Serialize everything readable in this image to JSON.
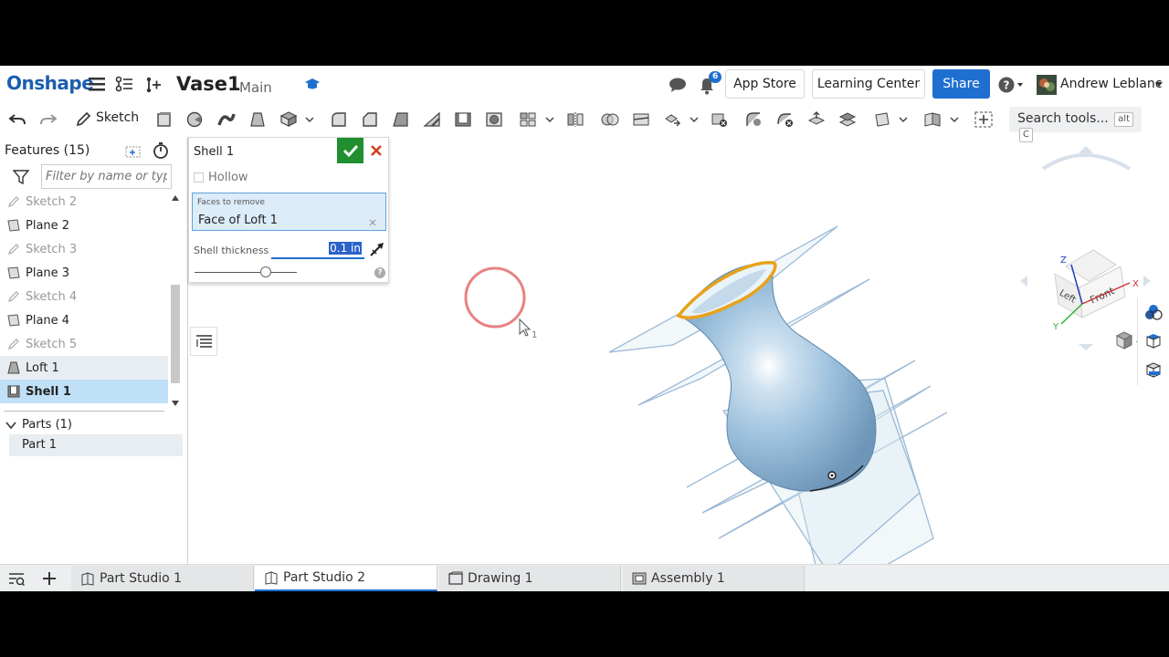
{
  "app": {
    "logo": "Onshape",
    "doc_title": "Vase1",
    "branch": "Main",
    "notification_count": "6",
    "app_store": "App Store",
    "learning_center": "Learning Center",
    "share": "Share",
    "user_name": "Andrew Leblanc"
  },
  "toolbar": {
    "sketch_label": "Sketch",
    "search_label": "Search tools...",
    "search_key_alt": "alt",
    "search_key_c": "C"
  },
  "features": {
    "header": "Features (15)",
    "filter_placeholder": "Filter by name or type",
    "items": [
      {
        "label": "Sketch 2",
        "type": "sketch"
      },
      {
        "label": "Plane 2",
        "type": "plane"
      },
      {
        "label": "Sketch 3",
        "type": "sketch"
      },
      {
        "label": "Plane 3",
        "type": "plane"
      },
      {
        "label": "Sketch 4",
        "type": "sketch"
      },
      {
        "label": "Plane 4",
        "type": "plane"
      },
      {
        "label": "Sketch 5",
        "type": "sketch"
      },
      {
        "label": "Loft 1",
        "type": "loft"
      },
      {
        "label": "Shell 1",
        "type": "shell"
      }
    ],
    "parts_header": "Parts (1)",
    "part": "Part 1"
  },
  "shell_dialog": {
    "title": "Shell 1",
    "hollow_label": "Hollow",
    "faces_label": "Faces to remove",
    "faces_value": "Face of Loft 1",
    "thickness_label": "Shell thickness",
    "thickness_value": "0.1 in",
    "help": "?"
  },
  "view_cube": {
    "face_front": "Front",
    "face_left": "Left",
    "axis_x": "X",
    "axis_y": "Y",
    "axis_z": "Z"
  },
  "viewport": {
    "cursor_badge": "1"
  },
  "tabs": [
    {
      "label": "Part Studio 1",
      "active": false
    },
    {
      "label": "Part Studio 2",
      "active": true
    },
    {
      "label": "Drawing 1",
      "active": false
    },
    {
      "label": "Assembly 1",
      "active": false
    }
  ],
  "colors": {
    "brand": "#1b5fae",
    "accent": "#1f6fd0",
    "confirm": "#1f8f2f",
    "cancel": "#d0401f",
    "part_body": "#9fc3de",
    "edge_highlight": "#e8a21a"
  }
}
